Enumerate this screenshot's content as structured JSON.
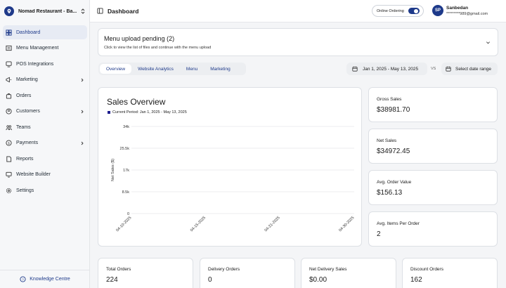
{
  "brand": {
    "name": "Nomad Restaurant - Ba..."
  },
  "sidebar": {
    "items": [
      {
        "label": "Dashboard"
      },
      {
        "label": "Menu Management"
      },
      {
        "label": "POS Integrations"
      },
      {
        "label": "Marketing"
      },
      {
        "label": "Orders"
      },
      {
        "label": "Customers"
      },
      {
        "label": "Teams"
      },
      {
        "label": "Payments"
      },
      {
        "label": "Reports"
      },
      {
        "label": "Website Builder"
      },
      {
        "label": "Settings"
      }
    ],
    "knowledge_label": "Knowledge Centre"
  },
  "header": {
    "title": "Dashboard",
    "online_ordering_label": "Online Ordering",
    "online_ordering_on": true,
    "avatar_initials": "SP",
    "user_name": "Sanbedan",
    "user_phone": "*********989@gmail.com"
  },
  "banner": {
    "title": "Menu upload pending (2)",
    "subtitle": "Click to view the list of files and continue with the menu upload"
  },
  "tabs": [
    {
      "label": "Overview"
    },
    {
      "label": "Website Analytics"
    },
    {
      "label": "Menu"
    },
    {
      "label": "Marketing"
    }
  ],
  "date_range": {
    "label": "Jan 1, 2025 - May 13, 2025",
    "vs": "VS",
    "compare_label": "Select date range"
  },
  "sales_overview": {
    "title": "Sales Overview",
    "legend": "Current Period: Jan 1, 2025 - May 13, 2025"
  },
  "chart_data": {
    "type": "line",
    "title": "Sales Overview",
    "ylabel": "Net Sales ($)",
    "xlabel": "",
    "y_ticks": [
      "34k",
      "25.5k",
      "17k",
      "8.5k",
      "0"
    ],
    "x_ticks": [
      "04-10-2025",
      "04-15-2025",
      "04-21-2025",
      "04-30-2025"
    ],
    "ylim": [
      0,
      34000
    ],
    "series": [],
    "grid": true
  },
  "metrics": [
    {
      "label": "Gross Sales",
      "value": "$38981.70"
    },
    {
      "label": "Net Sales",
      "value": "$34972.45"
    },
    {
      "label": "Avg. Order Value",
      "value": "$156.13"
    },
    {
      "label": "Avg. Items Per Order",
      "value": "2"
    }
  ],
  "bottom_metrics": [
    {
      "label": "Total Orders",
      "value": "224"
    },
    {
      "label": "Delivery Orders",
      "value": "0"
    },
    {
      "label": "Net Delivery Sales",
      "value": "$0.00"
    },
    {
      "label": "Discount Orders",
      "value": "162"
    }
  ],
  "colors": {
    "accent": "#1e3a8a",
    "legend": "#1e1e8f",
    "grid": "#e6e7ea"
  }
}
